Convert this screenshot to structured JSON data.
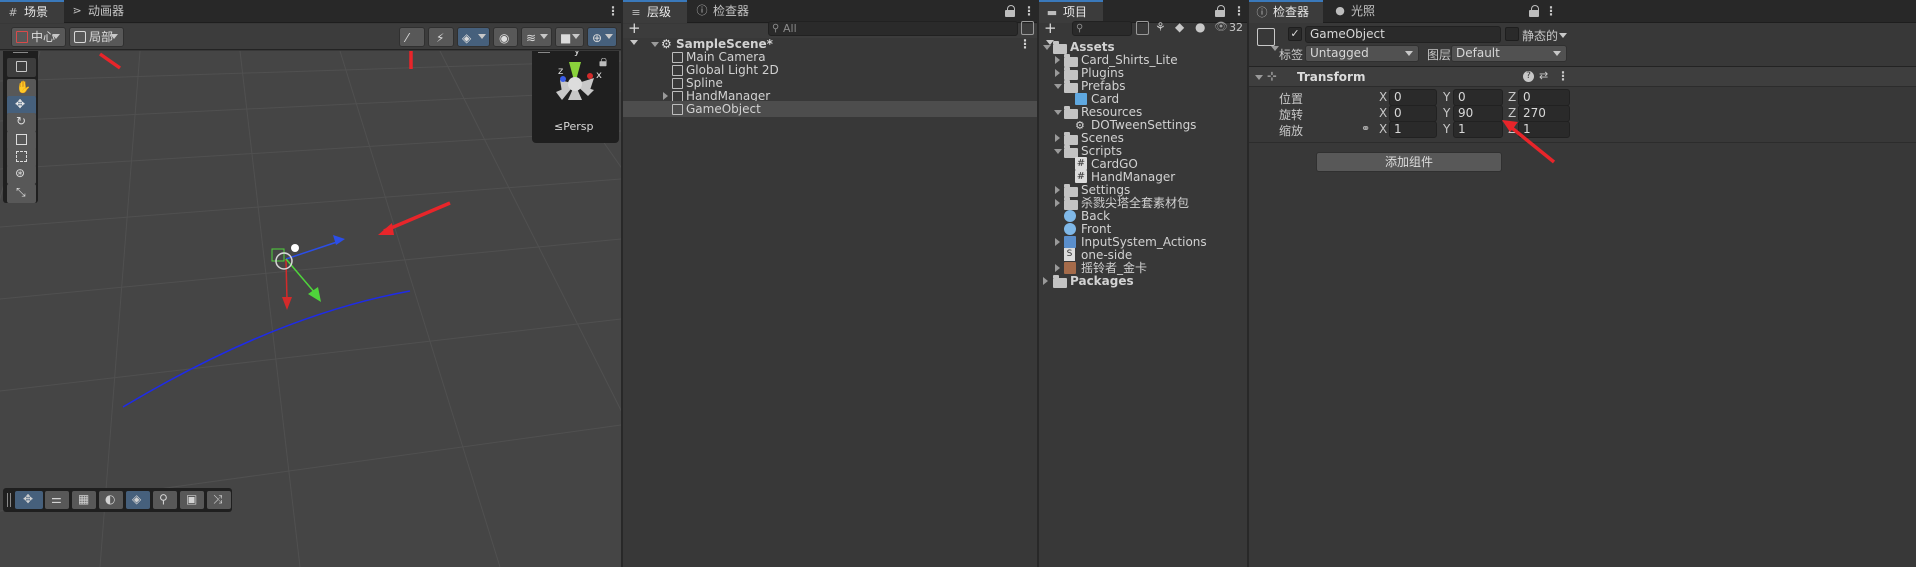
{
  "scene": {
    "tabs": [
      {
        "label": "场景"
      },
      {
        "label": "动画器"
      }
    ],
    "pivot_label": "中心",
    "space_label": "局部",
    "persp_label": "≤Persp",
    "gizmo_axes": {
      "y": "y",
      "x": "x",
      "z": "z"
    }
  },
  "hierarchy": {
    "tabs": [
      {
        "label": "层级"
      },
      {
        "label": "检查器"
      }
    ],
    "search_placeholder": "All",
    "scene_name": "SampleScene*",
    "items": [
      {
        "label": "Main Camera"
      },
      {
        "label": "Global Light 2D"
      },
      {
        "label": "Spline"
      },
      {
        "label": "HandManager"
      },
      {
        "label": "GameObject"
      }
    ]
  },
  "project": {
    "tab": "项目",
    "count_badge": "32",
    "items": [
      {
        "label": "Assets"
      },
      {
        "label": "Card_Shirts_Lite"
      },
      {
        "label": "Plugins"
      },
      {
        "label": "Prefabs"
      },
      {
        "label": "Card"
      },
      {
        "label": "Resources"
      },
      {
        "label": "DOTweenSettings"
      },
      {
        "label": "Scenes"
      },
      {
        "label": "Scripts"
      },
      {
        "label": "CardGO"
      },
      {
        "label": "HandManager"
      },
      {
        "label": "Settings"
      },
      {
        "label": "杀戮尖塔全套素材包"
      },
      {
        "label": "Back"
      },
      {
        "label": "Front"
      },
      {
        "label": "InputSystem_Actions"
      },
      {
        "label": "one-side"
      },
      {
        "label": "摇铃者_金卡"
      },
      {
        "label": "Packages"
      }
    ]
  },
  "inspector": {
    "tabs": [
      {
        "label": "检查器"
      },
      {
        "label": "光照"
      }
    ],
    "object_name": "GameObject",
    "static_label": "静态的",
    "tag_label": "标签",
    "tag_value": "Untagged",
    "layer_label": "图层",
    "layer_value": "Default",
    "component_title": "Transform",
    "position": {
      "label": "位置",
      "x": "0",
      "y": "0",
      "z": "0"
    },
    "rotation": {
      "label": "旋转",
      "x": "0",
      "y": "90",
      "z": "270"
    },
    "scale": {
      "label": "缩放",
      "x": "1",
      "y": "1",
      "z": "1"
    },
    "axis_x": "X",
    "axis_y": "Y",
    "axis_z": "Z",
    "add_component_label": "添加组件"
  },
  "colors": {
    "accent": "#3a79bb",
    "selection": "#46607c",
    "annotation_arrow": "#e8252a"
  }
}
